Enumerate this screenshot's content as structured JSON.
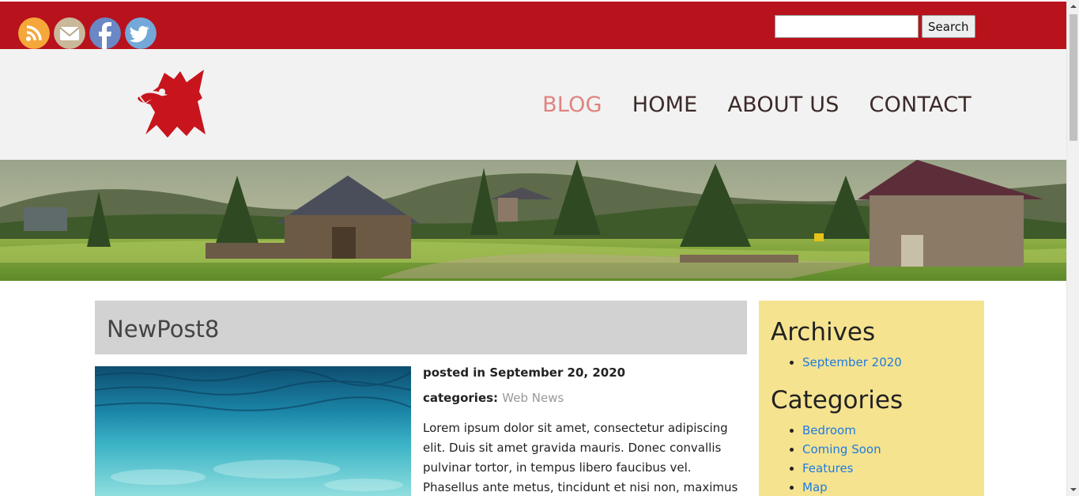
{
  "social": [
    {
      "name": "rss",
      "color": "#f5a73a"
    },
    {
      "name": "email",
      "color": "#c9b89a"
    },
    {
      "name": "facebook",
      "color": "#6a87c6"
    },
    {
      "name": "twitter",
      "color": "#73a8d8"
    }
  ],
  "search": {
    "button_label": "Search",
    "value": ""
  },
  "nav": {
    "blog": "BLOG",
    "home": "HOME",
    "about": "ABOUT US",
    "contact": "CONTACT"
  },
  "post": {
    "title": "NewPost8",
    "posted_label": "posted in",
    "posted_date": "September 20, 2020",
    "categories_label": "categories:",
    "category": "Web News",
    "body": "Lorem ipsum dolor sit amet, consectetur adipiscing elit. Duis sit amet gravida mauris. Donec convallis pulvinar tortor, in tempus libero faucibus vel. Phasellus ante metus, tincidunt et nisi non, maximus malesuada turpis. Donec"
  },
  "sidebar": {
    "archives_title": "Archives",
    "archives": [
      "September 2020"
    ],
    "categories_title": "Categories",
    "categories": [
      "Bedroom",
      "Coming Soon",
      "Features",
      "Map"
    ]
  },
  "colors": {
    "topbar": "#b8121c",
    "header": "#f2f2f2",
    "nav_active": "#e0837f",
    "sidebar": "#f6e38f",
    "link": "#1e7be0"
  }
}
